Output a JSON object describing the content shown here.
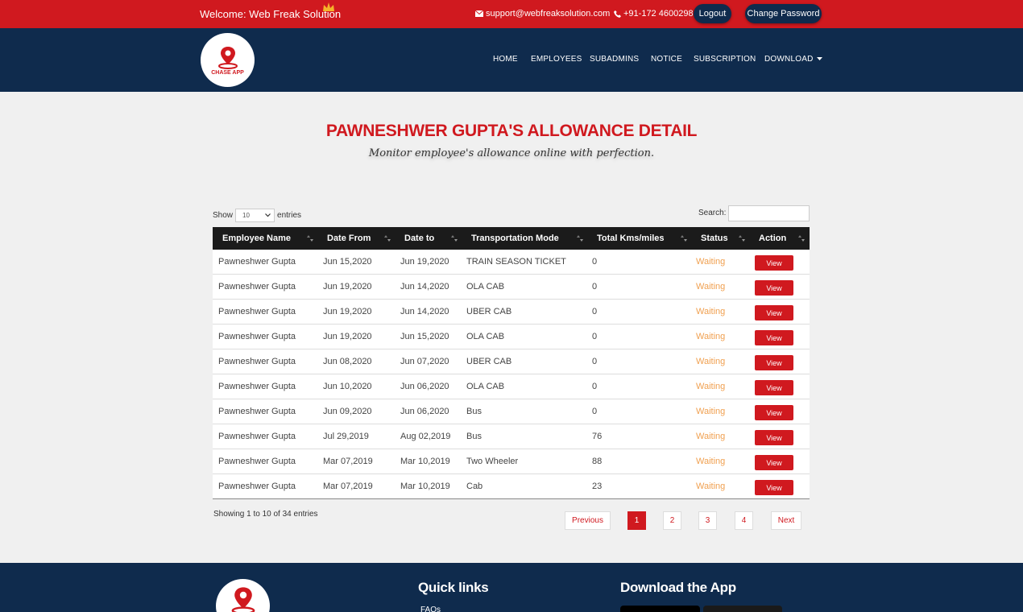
{
  "topbar": {
    "welcome": "Welcome: Web Freak Solution",
    "email": "support@webfreaksolution.com",
    "phone": "+91-172 4600298",
    "logout_label": "Logout",
    "change_password_label": "Change Password"
  },
  "brand": {
    "logo_text": "CHASE APP",
    "accent_color": "#d0191f",
    "navy_color": "#0f2b4d"
  },
  "nav": {
    "home": "HOME",
    "employees": "EMPLOYEES",
    "subadmins": "SUBADMINS",
    "notice": "NOTICE",
    "subscription": "SUBSCRIPTION",
    "download": "DOWNLOAD"
  },
  "page": {
    "title": "PAWNESHWER GUPTA'S ALLOWANCE DETAIL",
    "subtitle": "Monitor employee's allowance online with perfection."
  },
  "controls": {
    "show_label": "Show",
    "entries_value": "10",
    "entries_label": "entries",
    "search_label": "Search:",
    "search_value": ""
  },
  "table": {
    "headers": [
      "Employee Name",
      "Date From",
      "Date to",
      "Transportation Mode",
      "Total Kms/miles",
      "Status",
      "Action"
    ],
    "view_label": "View",
    "rows": [
      {
        "name": "Pawneshwer Gupta",
        "from": "Jun 15,2020",
        "to": "Jun 19,2020",
        "mode": "TRAIN SEASON TICKET",
        "kms": "0",
        "status": "Waiting"
      },
      {
        "name": "Pawneshwer Gupta",
        "from": "Jun 19,2020",
        "to": "Jun 14,2020",
        "mode": "OLA CAB",
        "kms": "0",
        "status": "Waiting"
      },
      {
        "name": "Pawneshwer Gupta",
        "from": "Jun 19,2020",
        "to": "Jun 14,2020",
        "mode": "UBER CAB",
        "kms": "0",
        "status": "Waiting"
      },
      {
        "name": "Pawneshwer Gupta",
        "from": "Jun 19,2020",
        "to": "Jun 15,2020",
        "mode": "OLA CAB",
        "kms": "0",
        "status": "Waiting"
      },
      {
        "name": "Pawneshwer Gupta",
        "from": "Jun 08,2020",
        "to": "Jun 07,2020",
        "mode": "UBER CAB",
        "kms": "0",
        "status": "Waiting"
      },
      {
        "name": "Pawneshwer Gupta",
        "from": "Jun 10,2020",
        "to": "Jun 06,2020",
        "mode": "OLA CAB",
        "kms": "0",
        "status": "Waiting"
      },
      {
        "name": "Pawneshwer Gupta",
        "from": "Jun 09,2020",
        "to": "Jun 06,2020",
        "mode": "Bus",
        "kms": "0",
        "status": "Waiting"
      },
      {
        "name": "Pawneshwer Gupta",
        "from": "Jul 29,2019",
        "to": "Aug 02,2019",
        "mode": "Bus",
        "kms": "76",
        "status": "Waiting"
      },
      {
        "name": "Pawneshwer Gupta",
        "from": "Mar 07,2019",
        "to": "Mar 10,2019",
        "mode": "Two Wheeler",
        "kms": "88",
        "status": "Waiting"
      },
      {
        "name": "Pawneshwer Gupta",
        "from": "Mar 07,2019",
        "to": "Mar 10,2019",
        "mode": "Cab",
        "kms": "23",
        "status": "Waiting"
      }
    ]
  },
  "pagination": {
    "info": "Showing 1 to 10 of 34 entries",
    "previous": "Previous",
    "pages": [
      "1",
      "2",
      "3",
      "4"
    ],
    "current_page": "1",
    "next": "Next"
  },
  "footer": {
    "quick_links_title": "Quick links",
    "first_link": "FAQs",
    "download_title": "Download the App"
  }
}
